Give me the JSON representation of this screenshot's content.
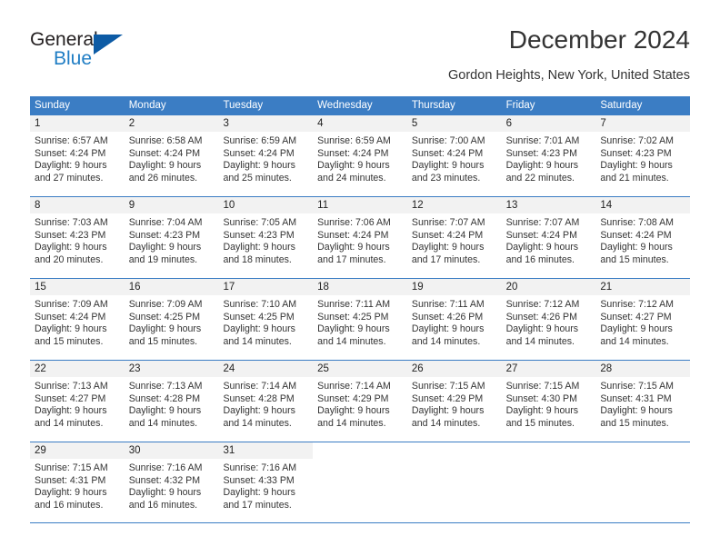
{
  "brand": {
    "name_top": "General",
    "name_bottom": "Blue",
    "triangle_color": "#0d5ba5",
    "blue_color": "#1f7dc4"
  },
  "header": {
    "title": "December 2024",
    "location": "Gordon Heights, New York, United States"
  },
  "theme": {
    "header_bar": "#3b7dc4",
    "day_number_bg": "#f2f2f2",
    "text": "#333333"
  },
  "weekday_headers": [
    "Sunday",
    "Monday",
    "Tuesday",
    "Wednesday",
    "Thursday",
    "Friday",
    "Saturday"
  ],
  "weeks": [
    [
      {
        "day": "1",
        "sunrise": "Sunrise: 6:57 AM",
        "sunset": "Sunset: 4:24 PM",
        "daylight1": "Daylight: 9 hours",
        "daylight2": "and 27 minutes."
      },
      {
        "day": "2",
        "sunrise": "Sunrise: 6:58 AM",
        "sunset": "Sunset: 4:24 PM",
        "daylight1": "Daylight: 9 hours",
        "daylight2": "and 26 minutes."
      },
      {
        "day": "3",
        "sunrise": "Sunrise: 6:59 AM",
        "sunset": "Sunset: 4:24 PM",
        "daylight1": "Daylight: 9 hours",
        "daylight2": "and 25 minutes."
      },
      {
        "day": "4",
        "sunrise": "Sunrise: 6:59 AM",
        "sunset": "Sunset: 4:24 PM",
        "daylight1": "Daylight: 9 hours",
        "daylight2": "and 24 minutes."
      },
      {
        "day": "5",
        "sunrise": "Sunrise: 7:00 AM",
        "sunset": "Sunset: 4:24 PM",
        "daylight1": "Daylight: 9 hours",
        "daylight2": "and 23 minutes."
      },
      {
        "day": "6",
        "sunrise": "Sunrise: 7:01 AM",
        "sunset": "Sunset: 4:23 PM",
        "daylight1": "Daylight: 9 hours",
        "daylight2": "and 22 minutes."
      },
      {
        "day": "7",
        "sunrise": "Sunrise: 7:02 AM",
        "sunset": "Sunset: 4:23 PM",
        "daylight1": "Daylight: 9 hours",
        "daylight2": "and 21 minutes."
      }
    ],
    [
      {
        "day": "8",
        "sunrise": "Sunrise: 7:03 AM",
        "sunset": "Sunset: 4:23 PM",
        "daylight1": "Daylight: 9 hours",
        "daylight2": "and 20 minutes."
      },
      {
        "day": "9",
        "sunrise": "Sunrise: 7:04 AM",
        "sunset": "Sunset: 4:23 PM",
        "daylight1": "Daylight: 9 hours",
        "daylight2": "and 19 minutes."
      },
      {
        "day": "10",
        "sunrise": "Sunrise: 7:05 AM",
        "sunset": "Sunset: 4:23 PM",
        "daylight1": "Daylight: 9 hours",
        "daylight2": "and 18 minutes."
      },
      {
        "day": "11",
        "sunrise": "Sunrise: 7:06 AM",
        "sunset": "Sunset: 4:24 PM",
        "daylight1": "Daylight: 9 hours",
        "daylight2": "and 17 minutes."
      },
      {
        "day": "12",
        "sunrise": "Sunrise: 7:07 AM",
        "sunset": "Sunset: 4:24 PM",
        "daylight1": "Daylight: 9 hours",
        "daylight2": "and 17 minutes."
      },
      {
        "day": "13",
        "sunrise": "Sunrise: 7:07 AM",
        "sunset": "Sunset: 4:24 PM",
        "daylight1": "Daylight: 9 hours",
        "daylight2": "and 16 minutes."
      },
      {
        "day": "14",
        "sunrise": "Sunrise: 7:08 AM",
        "sunset": "Sunset: 4:24 PM",
        "daylight1": "Daylight: 9 hours",
        "daylight2": "and 15 minutes."
      }
    ],
    [
      {
        "day": "15",
        "sunrise": "Sunrise: 7:09 AM",
        "sunset": "Sunset: 4:24 PM",
        "daylight1": "Daylight: 9 hours",
        "daylight2": "and 15 minutes."
      },
      {
        "day": "16",
        "sunrise": "Sunrise: 7:09 AM",
        "sunset": "Sunset: 4:25 PM",
        "daylight1": "Daylight: 9 hours",
        "daylight2": "and 15 minutes."
      },
      {
        "day": "17",
        "sunrise": "Sunrise: 7:10 AM",
        "sunset": "Sunset: 4:25 PM",
        "daylight1": "Daylight: 9 hours",
        "daylight2": "and 14 minutes."
      },
      {
        "day": "18",
        "sunrise": "Sunrise: 7:11 AM",
        "sunset": "Sunset: 4:25 PM",
        "daylight1": "Daylight: 9 hours",
        "daylight2": "and 14 minutes."
      },
      {
        "day": "19",
        "sunrise": "Sunrise: 7:11 AM",
        "sunset": "Sunset: 4:26 PM",
        "daylight1": "Daylight: 9 hours",
        "daylight2": "and 14 minutes."
      },
      {
        "day": "20",
        "sunrise": "Sunrise: 7:12 AM",
        "sunset": "Sunset: 4:26 PM",
        "daylight1": "Daylight: 9 hours",
        "daylight2": "and 14 minutes."
      },
      {
        "day": "21",
        "sunrise": "Sunrise: 7:12 AM",
        "sunset": "Sunset: 4:27 PM",
        "daylight1": "Daylight: 9 hours",
        "daylight2": "and 14 minutes."
      }
    ],
    [
      {
        "day": "22",
        "sunrise": "Sunrise: 7:13 AM",
        "sunset": "Sunset: 4:27 PM",
        "daylight1": "Daylight: 9 hours",
        "daylight2": "and 14 minutes."
      },
      {
        "day": "23",
        "sunrise": "Sunrise: 7:13 AM",
        "sunset": "Sunset: 4:28 PM",
        "daylight1": "Daylight: 9 hours",
        "daylight2": "and 14 minutes."
      },
      {
        "day": "24",
        "sunrise": "Sunrise: 7:14 AM",
        "sunset": "Sunset: 4:28 PM",
        "daylight1": "Daylight: 9 hours",
        "daylight2": "and 14 minutes."
      },
      {
        "day": "25",
        "sunrise": "Sunrise: 7:14 AM",
        "sunset": "Sunset: 4:29 PM",
        "daylight1": "Daylight: 9 hours",
        "daylight2": "and 14 minutes."
      },
      {
        "day": "26",
        "sunrise": "Sunrise: 7:15 AM",
        "sunset": "Sunset: 4:29 PM",
        "daylight1": "Daylight: 9 hours",
        "daylight2": "and 14 minutes."
      },
      {
        "day": "27",
        "sunrise": "Sunrise: 7:15 AM",
        "sunset": "Sunset: 4:30 PM",
        "daylight1": "Daylight: 9 hours",
        "daylight2": "and 15 minutes."
      },
      {
        "day": "28",
        "sunrise": "Sunrise: 7:15 AM",
        "sunset": "Sunset: 4:31 PM",
        "daylight1": "Daylight: 9 hours",
        "daylight2": "and 15 minutes."
      }
    ],
    [
      {
        "day": "29",
        "sunrise": "Sunrise: 7:15 AM",
        "sunset": "Sunset: 4:31 PM",
        "daylight1": "Daylight: 9 hours",
        "daylight2": "and 16 minutes."
      },
      {
        "day": "30",
        "sunrise": "Sunrise: 7:16 AM",
        "sunset": "Sunset: 4:32 PM",
        "daylight1": "Daylight: 9 hours",
        "daylight2": "and 16 minutes."
      },
      {
        "day": "31",
        "sunrise": "Sunrise: 7:16 AM",
        "sunset": "Sunset: 4:33 PM",
        "daylight1": "Daylight: 9 hours",
        "daylight2": "and 17 minutes."
      },
      {
        "day": "",
        "sunrise": "",
        "sunset": "",
        "daylight1": "",
        "daylight2": ""
      },
      {
        "day": "",
        "sunrise": "",
        "sunset": "",
        "daylight1": "",
        "daylight2": ""
      },
      {
        "day": "",
        "sunrise": "",
        "sunset": "",
        "daylight1": "",
        "daylight2": ""
      },
      {
        "day": "",
        "sunrise": "",
        "sunset": "",
        "daylight1": "",
        "daylight2": ""
      }
    ]
  ]
}
